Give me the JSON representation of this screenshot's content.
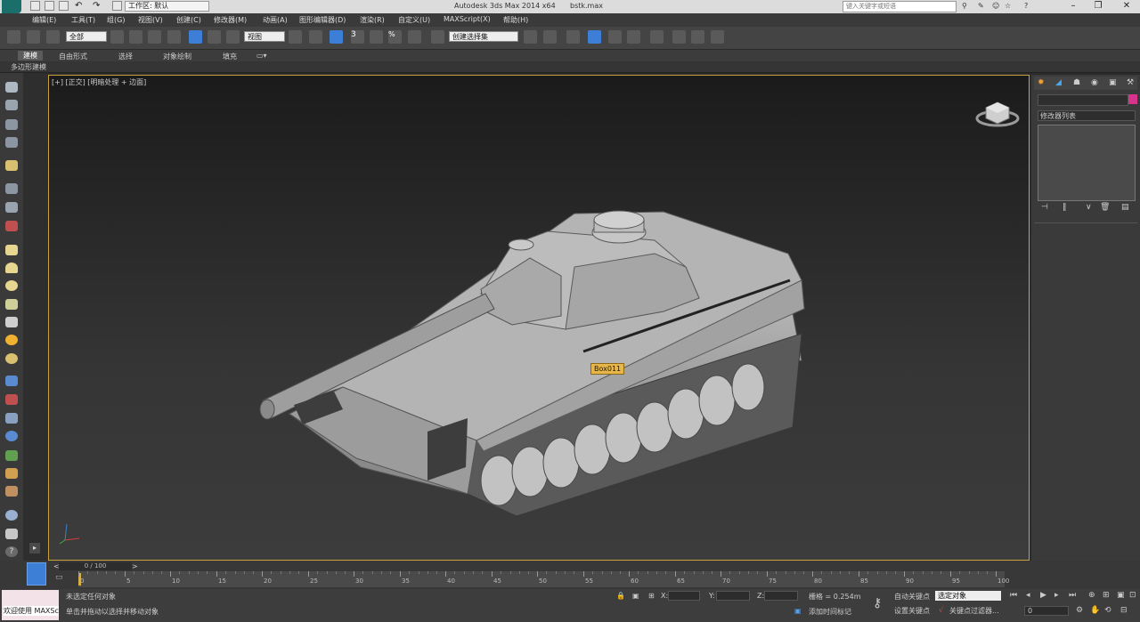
{
  "titlebar": {
    "app_title": "Autodesk 3ds Max  2014 x64",
    "file_name": "bstk.max",
    "workspace": "工作区: 默认",
    "search_placeholder": "键入关键字或短语"
  },
  "menu": [
    "编辑(E)",
    "工具(T)",
    "组(G)",
    "视图(V)",
    "创建(C)",
    "修改器(M)",
    "动画(A)",
    "图形编辑器(D)",
    "渲染(R)",
    "自定义(U)",
    "MAXScript(X)",
    "帮助(H)"
  ],
  "toolbar": {
    "selection_filter": "全部",
    "ref_coord": "视图",
    "named_selection": "创建选择集",
    "snap_3": "3",
    "snap_2_5": "2.5",
    "angle_snap": "%"
  },
  "ribbon": {
    "tabs": [
      "建模",
      "自由形式",
      "选择",
      "对象绘制",
      "填充"
    ],
    "active": "建模",
    "sub": "多边形建模"
  },
  "viewport": {
    "label": "[+] [正交] [明暗处理 + 边面]",
    "object_label": "Box011"
  },
  "command_panel": {
    "modifier_list": "修改器列表"
  },
  "timeline": {
    "frame_display": "0 / 100",
    "ticks": [
      "0",
      "5",
      "10",
      "15",
      "20",
      "25",
      "30",
      "35",
      "40",
      "45",
      "50",
      "55",
      "60",
      "65",
      "70",
      "75",
      "80",
      "85",
      "90",
      "95",
      "100"
    ]
  },
  "status": {
    "welcome": "欢迎使用 MAXSc",
    "line1": "未选定任何对象",
    "line2": "单击并拖动以选择并移动对象",
    "x_label": "X:",
    "y_label": "Y:",
    "z_label": "Z:",
    "grid": "栅格 = 0.254m",
    "auto_key": "自动关键点",
    "set_key": "设置关键点",
    "selected_dropdown": "选定对象",
    "key_filters": "关键点过滤器...",
    "add_time_tag": "添加时间标记",
    "frame_field": "0"
  },
  "colors": {
    "accent_blue": "#3d7fd6",
    "viewport_border": "#c8a23c",
    "object_label_bg": "#e7b54a",
    "color_swatch": "#d6338c"
  }
}
